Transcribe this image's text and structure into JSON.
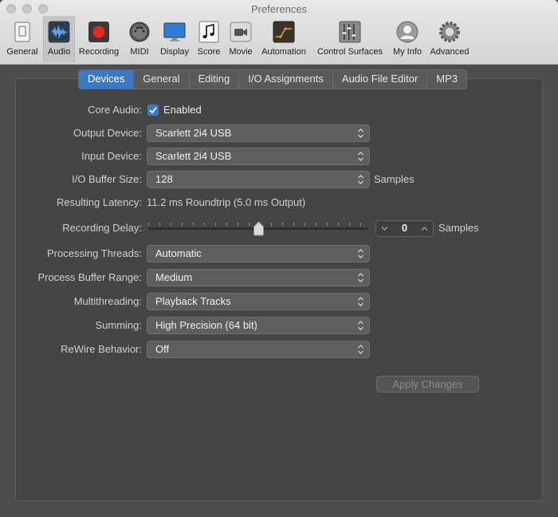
{
  "window": {
    "title": "Preferences"
  },
  "toolbar": [
    {
      "label": "General",
      "icon": "general-icon"
    },
    {
      "label": "Audio",
      "icon": "audio-icon",
      "selected": true
    },
    {
      "label": "Recording",
      "icon": "recording-icon"
    },
    {
      "label": "MIDI",
      "icon": "midi-icon"
    },
    {
      "label": "Display",
      "icon": "display-icon"
    },
    {
      "label": "Score",
      "icon": "score-icon"
    },
    {
      "label": "Movie",
      "icon": "movie-icon"
    },
    {
      "label": "Automation",
      "icon": "automation-icon"
    },
    {
      "label": "Control Surfaces",
      "icon": "control-surfaces-icon"
    },
    {
      "label": "My Info",
      "icon": "my-info-icon"
    },
    {
      "label": "Advanced",
      "icon": "advanced-icon"
    }
  ],
  "tabs": [
    {
      "label": "Devices",
      "active": true
    },
    {
      "label": "General"
    },
    {
      "label": "Editing"
    },
    {
      "label": "I/O Assignments"
    },
    {
      "label": "Audio File Editor"
    },
    {
      "label": "MP3"
    }
  ],
  "devices": {
    "core_audio": {
      "label": "Core Audio:",
      "checkbox_label": "Enabled",
      "checked": true
    },
    "output_device": {
      "label": "Output Device:",
      "value": "Scarlett 2i4 USB"
    },
    "input_device": {
      "label": "Input Device:",
      "value": "Scarlett 2i4 USB"
    },
    "io_buffer": {
      "label": "I/O Buffer Size:",
      "value": "128",
      "suffix": "Samples"
    },
    "latency": {
      "label": "Resulting Latency:",
      "value": "11.2 ms Roundtrip (5.0 ms Output)"
    },
    "recording_delay": {
      "label": "Recording Delay:",
      "value": "0",
      "suffix": "Samples",
      "slider_fraction": 0.5
    },
    "processing_threads": {
      "label": "Processing Threads:",
      "value": "Automatic"
    },
    "process_buffer_range": {
      "label": "Process Buffer Range:",
      "value": "Medium"
    },
    "multithreading": {
      "label": "Multithreading:",
      "value": "Playback Tracks"
    },
    "summing": {
      "label": "Summing:",
      "value": "High Precision (64 bit)"
    },
    "rewire": {
      "label": "ReWire Behavior:",
      "value": "Off"
    },
    "apply_label": "Apply Changes"
  },
  "colors": {
    "accent": "#3c79c4",
    "panel": "#454545",
    "window": "#4d4d4d"
  }
}
